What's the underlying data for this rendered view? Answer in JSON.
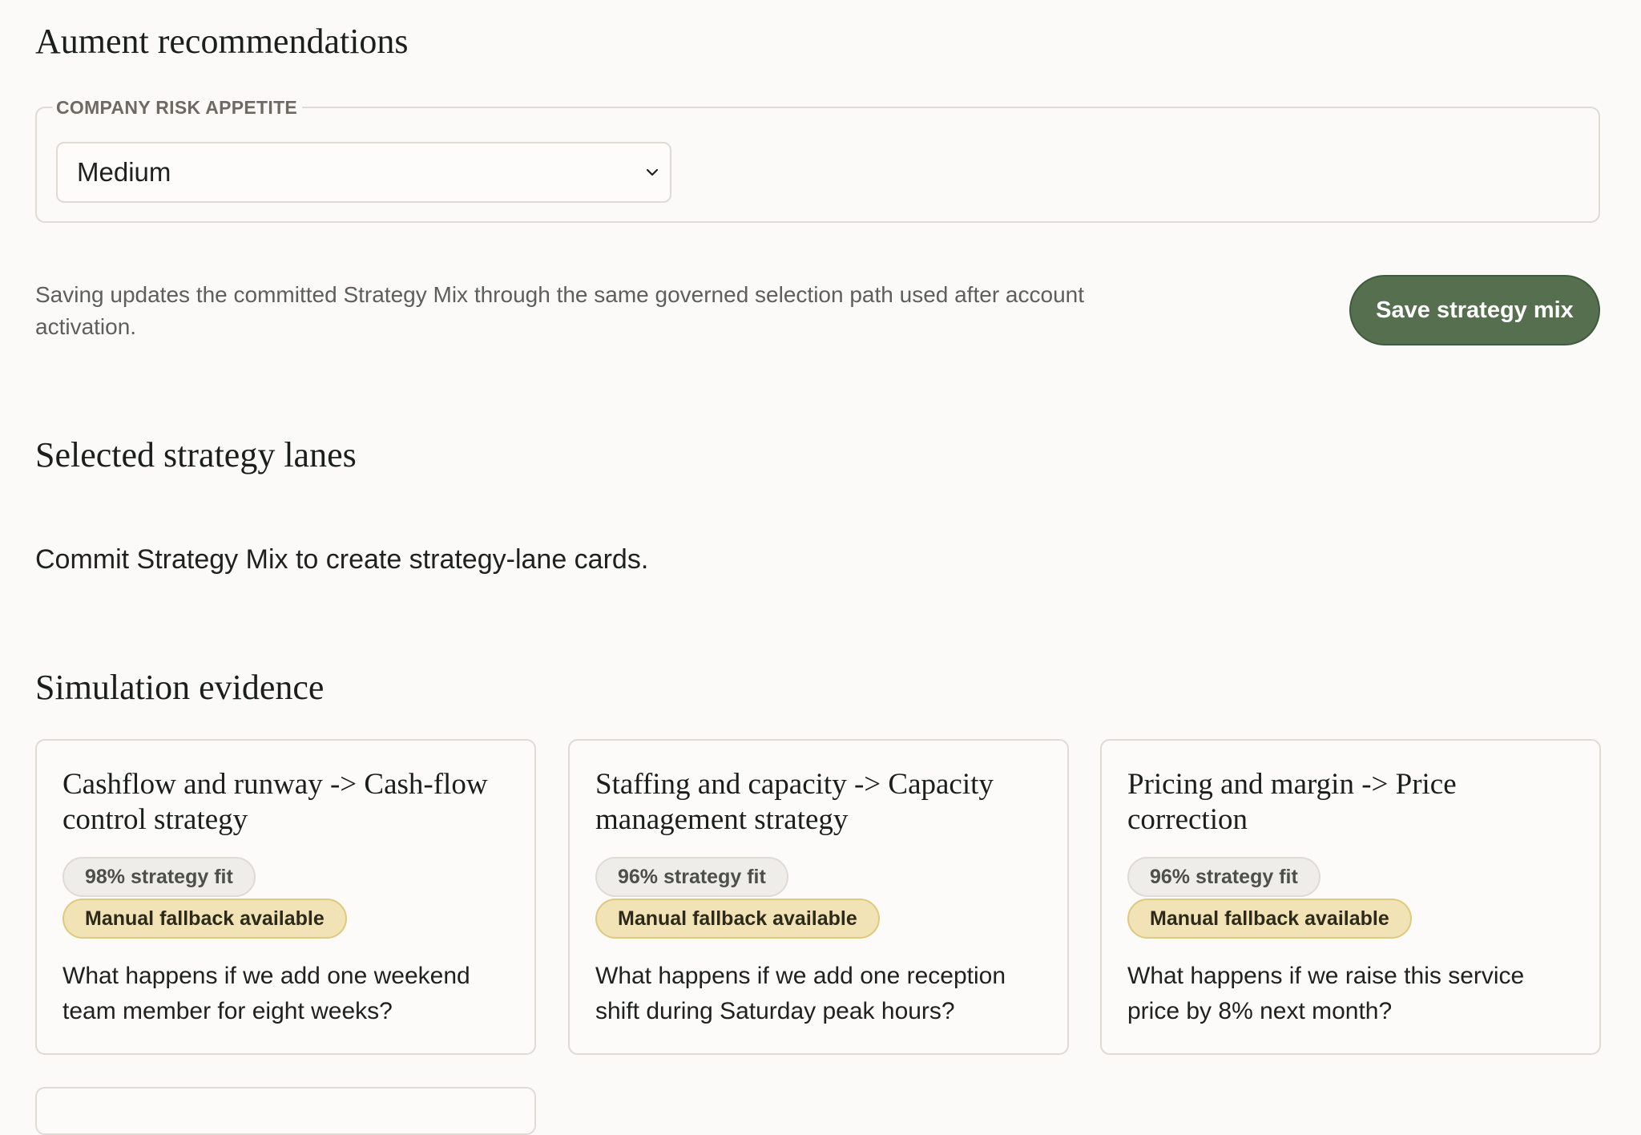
{
  "recommendations": {
    "title": "Aument recommendations",
    "risk_appetite": {
      "legend": "COMPANY RISK APPETITE",
      "selected": "Medium",
      "icon": "chevron-down-icon"
    },
    "save_note": "Saving updates the committed Strategy Mix through the same governed selection path used after account activation.",
    "save_label": "Save strategy mix"
  },
  "lanes": {
    "title": "Selected strategy lanes",
    "empty_message": "Commit Strategy Mix to create strategy-lane cards."
  },
  "simulation": {
    "title": "Simulation evidence",
    "cards": [
      {
        "title": "Cashflow and runway -> Cash-flow control strategy",
        "fit": "98% strategy fit",
        "fallback": "Manual fallback available",
        "question": "What happens if we add one weekend team member for eight weeks?"
      },
      {
        "title": "Staffing and capacity -> Capacity management strategy",
        "fit": "96% strategy fit",
        "fallback": "Manual fallback available",
        "question": "What happens if we add one reception shift during Saturday peak hours?"
      },
      {
        "title": "Pricing and margin -> Price correction",
        "fit": "96% strategy fit",
        "fallback": "Manual fallback available",
        "question": "What happens if we raise this service price by 8% next month?"
      }
    ]
  },
  "colors": {
    "background": "#fbfaf8",
    "accent_green": "#56704f",
    "fallback_badge": "#f1e3b6",
    "fit_badge": "#efede9",
    "border": "#dedbd5"
  }
}
